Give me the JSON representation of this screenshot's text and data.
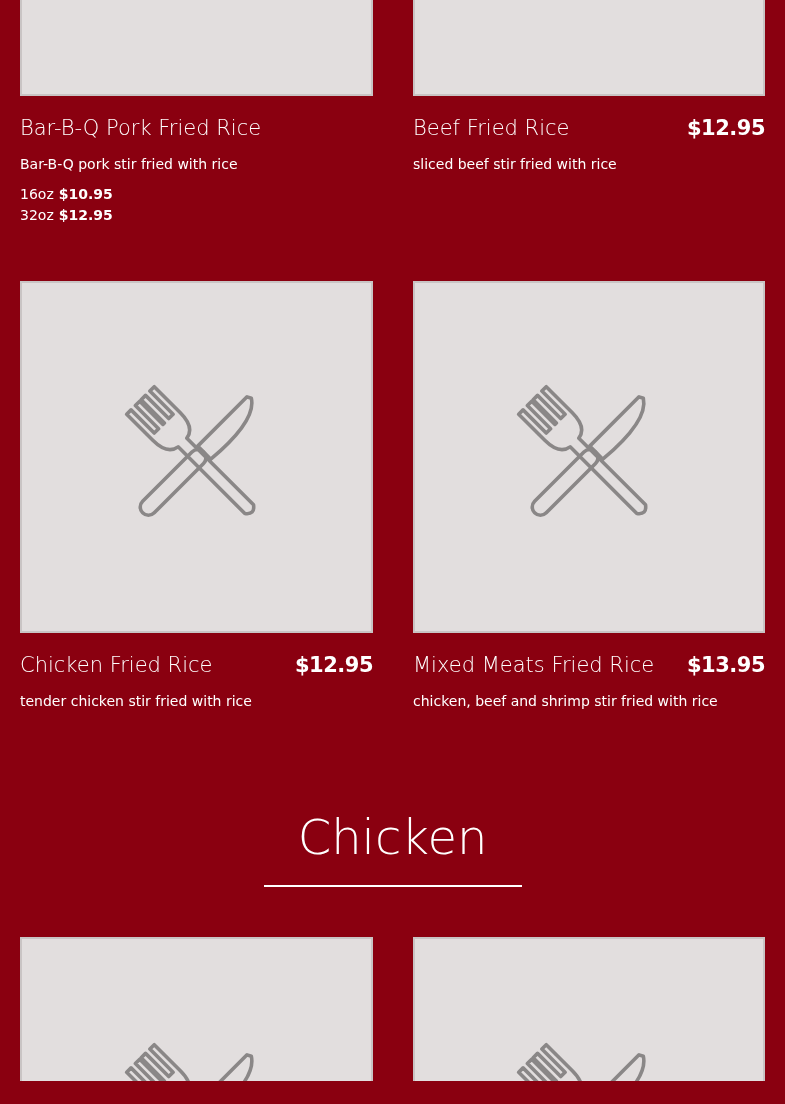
{
  "sections": [
    {
      "items": [
        {
          "kind": "placeholder",
          "title": "Bar-B-Q Pork Fried Rice",
          "description": "Bar-B-Q pork stir fried with rice",
          "sizes": [
            {
              "size": "16oz",
              "price": "$10.95"
            },
            {
              "size": "32oz",
              "price": "$12.95"
            }
          ]
        },
        {
          "kind": "placeholder",
          "title": "Beef Fried Rice",
          "price": "$12.95",
          "description": "sliced beef stir fried with rice"
        },
        {
          "kind": "placeholder",
          "title": "Chicken Fried Rice",
          "price": "$12.95",
          "description": "tender chicken stir fried with rice"
        },
        {
          "kind": "placeholder",
          "title": "Mixed Meats Fried Rice",
          "price": "$13.95",
          "description": "chicken, beef and shrimp stir fried with rice"
        }
      ]
    },
    {
      "heading": "Chicken",
      "items": [
        {
          "kind": "placeholder"
        },
        {
          "kind": "placeholder"
        }
      ]
    }
  ]
}
